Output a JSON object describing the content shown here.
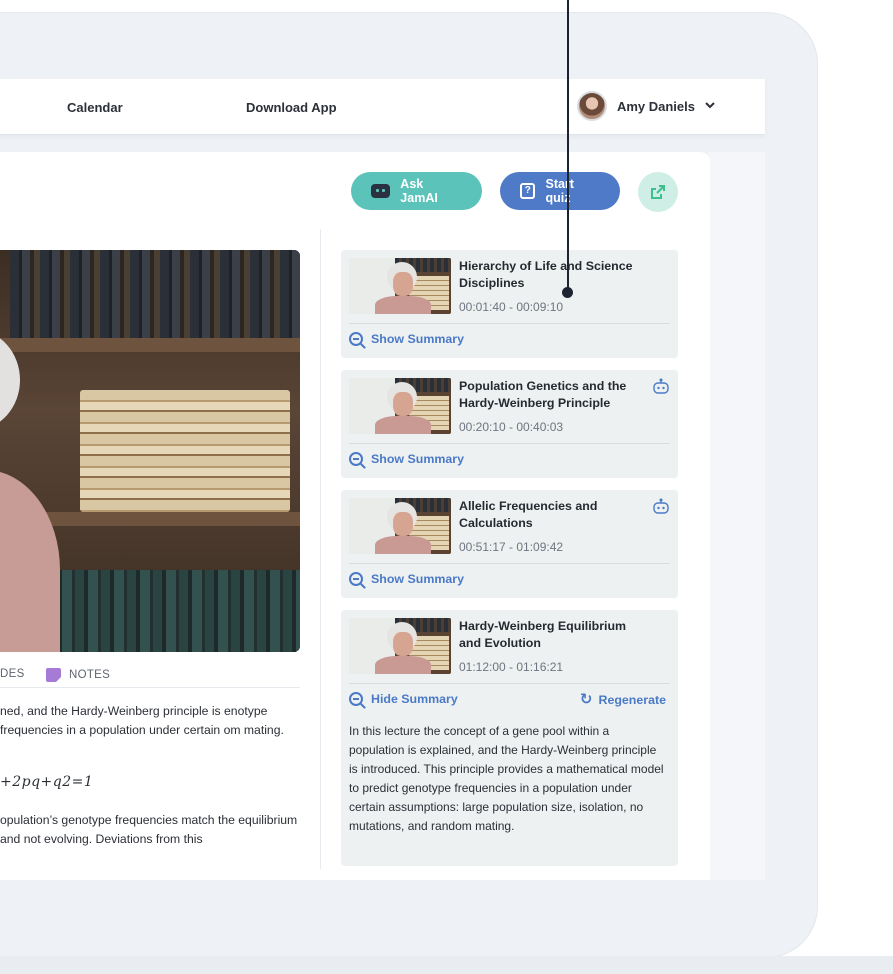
{
  "nav": {
    "calendar": "Calendar",
    "download": "Download App"
  },
  "user": {
    "name": "Amy Daniels"
  },
  "actions": {
    "ask": "Ask JamAI",
    "quiz": "Start quiz"
  },
  "tabs": {
    "slides": "DES",
    "notes": "NOTES"
  },
  "notes": {
    "para1": "ned, and the Hardy-Weinberg principle is enotype frequencies in a population under certain om mating.",
    "formula": "+2pq+q2=1",
    "para2": "opulation’s genotype frequencies match the equilibrium and not evolving. Deviations from this"
  },
  "chapters": [
    {
      "title": "Hierarchy of Life and Science Disciplines",
      "time": "00:01:40 - 00:09:10",
      "action": "Show Summary"
    },
    {
      "title": "Population Genetics and the Hardy-Weinberg Principle",
      "time": "00:20:10 - 00:40:03",
      "action": "Show Summary"
    },
    {
      "title": "Allelic Frequencies and Calculations",
      "time": "00:51:17 - 01:09:42",
      "action": "Show Summary"
    },
    {
      "title": "Hardy-Weinberg Equilibrium and Evolution",
      "time": "01:12:00 - 01:16:21",
      "action": "Hide Summary",
      "regenerate": "Regenerate",
      "summary": "In this lecture the concept of a gene pool within a population is explained, and the Hardy-Weinberg principle is introduced. This principle provides a mathematical model to predict genotype frequencies in a population under certain assumptions: large population size, isolation, no mutations, and random mating."
    }
  ],
  "colors": {
    "accent_teal": "#5cc3bb",
    "accent_blue": "#4f7ac8",
    "link": "#4a7ac7",
    "notes_purple": "#a67bd6"
  }
}
